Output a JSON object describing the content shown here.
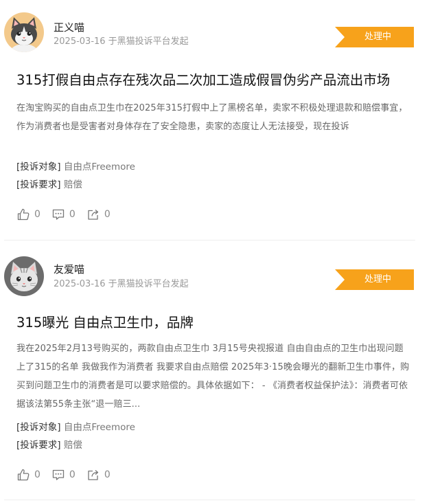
{
  "posts": [
    {
      "user": "正义喵",
      "meta": "2025-03-16 于黑猫投诉平台发起",
      "status": "处理中",
      "title": "315打假自由点存在残次品二次加工造成假冒伪劣产品流出市场",
      "description": "在淘宝购买的自由点卫生巾在2025年315打假中上了黑榜名单，卖家不积极处理退款和赔偿事宜，作为消费者也是受害者对身体存在了安全隐患，卖家的态度让人无法接受，现在投诉",
      "target_label": "[投诉对象]",
      "target_value": "自由点Freemore",
      "demand_label": "[投诉要求]",
      "demand_value": "赔偿",
      "likes": "0",
      "comments": "0",
      "shares": "0",
      "avatar_icon": "cat-avatar-gray-white"
    },
    {
      "user": "友爱喵",
      "meta": "2025-03-16 于黑猫投诉平台发起",
      "status": "处理中",
      "title": "315曝光 自由点卫生巾，品牌",
      "description": "我在2025年2月13号购买的，两款自由点卫生巾 3月15号央视报道 自由自由点的卫生巾出现问题 上了315的名单 我做我作为消费者 我要求自由点赔偿 2025年3·15晚会曝光的翻新卫生巾事件，购买到问题卫生巾的消费者是可以要求赔偿的。具体依据如下： - 《消费者权益保护法》：消费者可依据该法第55条主张“退一赔三...",
      "target_label": "[投诉对象]",
      "target_value": "自由点Freemore",
      "demand_label": "[投诉要求]",
      "demand_value": "赔偿",
      "likes": "0",
      "comments": "0",
      "shares": "0",
      "avatar_icon": "cat-avatar-striped-gray"
    }
  ],
  "colors": {
    "status_badge": "#f7a21b",
    "title": "#111111",
    "meta": "#999999",
    "description": "#666666"
  }
}
